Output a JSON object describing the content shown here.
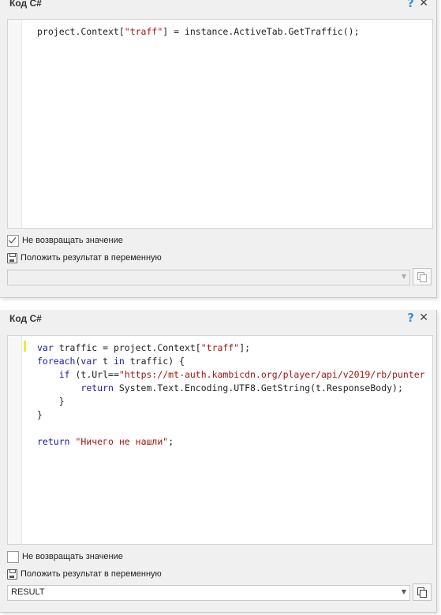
{
  "panels": [
    {
      "title": "Код C#",
      "help_icon": "?",
      "close_icon": "✕",
      "code_lines": [
        [
          {
            "t": "project.Context[",
            "c": "plain"
          },
          {
            "t": "\"traff\"",
            "c": "str"
          },
          {
            "t": "] = instance.ActiveTab.GetTraffic();",
            "c": "plain"
          }
        ]
      ],
      "options": {
        "no_return_label": "Не возвращать значение",
        "no_return_checked": true,
        "save_result_label": "Положить результат в переменную"
      },
      "variable": ""
    },
    {
      "title": "Код C#",
      "help_icon": "?",
      "close_icon": "✕",
      "code_lines": [
        [
          {
            "t": "var",
            "c": "kw"
          },
          {
            "t": " traffic = project.Context[",
            "c": "plain"
          },
          {
            "t": "\"traff\"",
            "c": "str"
          },
          {
            "t": "];",
            "c": "plain"
          }
        ],
        [
          {
            "t": "foreach",
            "c": "kw"
          },
          {
            "t": "(",
            "c": "plain"
          },
          {
            "t": "var",
            "c": "kw"
          },
          {
            "t": " t ",
            "c": "plain"
          },
          {
            "t": "in",
            "c": "kw"
          },
          {
            "t": " traffic) {",
            "c": "plain"
          }
        ],
        [
          {
            "t": "    ",
            "c": "plain"
          },
          {
            "t": "if",
            "c": "kw"
          },
          {
            "t": " (t.Url==",
            "c": "plain"
          },
          {
            "t": "\"https://mt-auth.kambicdn.org/player/api/v2019/rb/punter",
            "c": "str"
          }
        ],
        [
          {
            "t": "        ",
            "c": "plain"
          },
          {
            "t": "return",
            "c": "kw"
          },
          {
            "t": " System.Text.Encoding.UTF8.GetString(t.ResponseBody);",
            "c": "plain"
          }
        ],
        [
          {
            "t": "    }",
            "c": "plain"
          }
        ],
        [
          {
            "t": "}",
            "c": "plain"
          }
        ],
        [
          {
            "t": "",
            "c": "plain"
          }
        ],
        [
          {
            "t": "return",
            "c": "kw"
          },
          {
            "t": " ",
            "c": "plain"
          },
          {
            "t": "\"Ничего не нашли\"",
            "c": "str"
          },
          {
            "t": ";",
            "c": "plain"
          }
        ]
      ],
      "options": {
        "no_return_label": "Не возвращать значение",
        "no_return_checked": false,
        "save_result_label": "Положить результат в переменную"
      },
      "variable": "RESULT"
    }
  ],
  "select_arrow_icon": "▼",
  "colors": {
    "keyword": "#1a1aa6",
    "string": "#a31515",
    "accent": "#3d8ee0",
    "change_marker": "#f3e24a"
  }
}
